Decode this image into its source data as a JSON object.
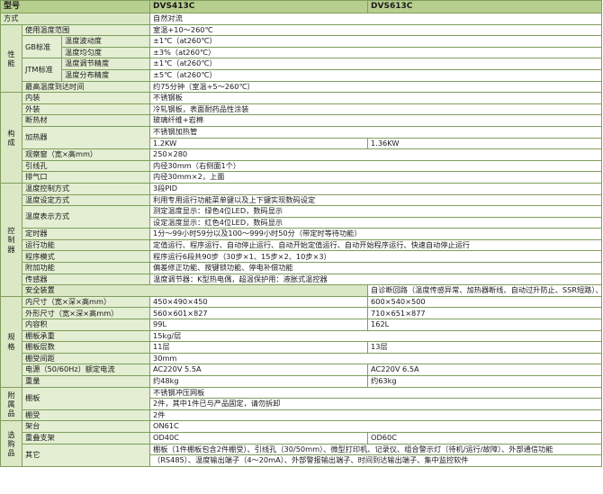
{
  "header": {
    "model": "型号",
    "m1": "DVS413C",
    "m2": "DVS613C"
  },
  "method": {
    "label": "方式",
    "value": "自然对流"
  },
  "performance": {
    "category": "性能",
    "temp_range": {
      "label": "使用温度范围",
      "value": "室温+10～260℃"
    },
    "gb_group": "GB标准",
    "fluctuation": {
      "label": "温度波动度",
      "value": "±1℃（at260℃）"
    },
    "uniformity": {
      "label": "温度均匀度",
      "value": "±3%（at260℃）"
    },
    "jtm_group": "JTM标准",
    "adjust": {
      "label": "温度调节精度",
      "value": "±1℃（at260℃）"
    },
    "distribution": {
      "label": "温度分布精度",
      "value": "±5℃（at260℃）"
    },
    "max_time": {
      "label": "最高温度到达时间",
      "value": "约75分钟（室温+5～260℃）"
    }
  },
  "construction": {
    "category": "构成",
    "inner": {
      "label": "内装",
      "value": "不锈钢板"
    },
    "outer": {
      "label": "外装",
      "value": "冷轧钢板，表面耐药品性涂装"
    },
    "insulation": {
      "label": "断热材",
      "value": "玻璃纤维+岩棉"
    },
    "heater": {
      "label": "加热器",
      "material": "不锈钢加热管",
      "p1": "1.2KW",
      "p2": "1.36KW"
    },
    "window": {
      "label": "观察窗（宽×高mm）",
      "value": "250×280"
    },
    "lead_hole": {
      "label": "引线孔",
      "value": "内径30mm（右侧面1个）"
    },
    "exhaust": {
      "label": "排气口",
      "value": "内径30mm×2，上面"
    }
  },
  "controller": {
    "category": "控制器",
    "control_method": {
      "label": "温度控制方式",
      "value": "3段PID"
    },
    "setting_method": {
      "label": "温度设定方式",
      "value": "利用专用运行功能菜单键以及上下键实现数码设定"
    },
    "display": {
      "label": "温度表示方式",
      "measured": "测定温度显示：绿色4位LED，数码显示",
      "set": "设定温度显示：红色4位LED，数码显示"
    },
    "timer": {
      "label": "定时器",
      "value": "1分～99小时59分以及100～999小时50分（带定时等待功能）"
    },
    "run_func": {
      "label": "运行功能",
      "value": "定值运行、程序运行、自动停止运行、自动开始定值运行、自动开始程序运行、快速自动停止运行"
    },
    "program": {
      "label": "程序模式",
      "value": "程序运行6段共90步（30步×1、15步×2、10步×3）"
    },
    "extra": {
      "label": "附加功能",
      "value": "偏差修正功能、按键锁功能、停电补偿功能"
    },
    "sensor": {
      "label": "传感器",
      "value": "温度调节器：K型热电偶，超温保护用：液胀式温控器"
    }
  },
  "safety": {
    "label": "安全装置",
    "value": "自诊断回路（温度传感异常、加热器断线、自动过升防止、SSR短路）、独立过升防止器、过电流漏电保护开关、按键锁功能"
  },
  "specs": {
    "category": "规格",
    "inner_size": {
      "label": "内尺寸（宽×深×高mm）",
      "v1": "450×490×450",
      "v2": "600×540×500"
    },
    "outer_size": {
      "label": "外形尺寸（宽×深×高mm）",
      "v1": "560×601×827",
      "v2": "710×651×877"
    },
    "volume": {
      "label": "内容积",
      "v1": "99L",
      "v2": "162L"
    },
    "shelf_load": {
      "label": "棚板承重",
      "value": "15kg/层"
    },
    "shelf_count": {
      "label": "棚板层数",
      "v1": "11层",
      "v2": "13层"
    },
    "shelf_gap": {
      "label": "棚受间距",
      "value": "30mm"
    },
    "power": {
      "label": "电源（50/60Hz）额定电流",
      "v1": "AC220V 5.5A",
      "v2": "AC220V 6.5A"
    },
    "weight": {
      "label": "重量",
      "v1": "约48kg",
      "v2": "约63kg"
    }
  },
  "accessories": {
    "category": "附属品",
    "shelf": {
      "label": "棚板",
      "material": "不锈钢冲压网板",
      "note": "2件，其中1件已与产品固定，请勿拆卸"
    },
    "shelf_rest": {
      "label": "棚受",
      "value": "2件"
    }
  },
  "options": {
    "category": "选购品",
    "stand": {
      "label": "架台",
      "value": "ON61C"
    },
    "stack": {
      "label": "重叠支架",
      "v1": "OD40C",
      "v2": "OD60C"
    },
    "other": {
      "label": "其它",
      "line1": "棚板（1件棚板包含2件棚受）、引线孔（30/50mm）、微型打印机、记录仪、组合警示灯（待机/运行/故障）、外部通信功能",
      "line2": "（RS485）、温度输出端子（4～20mA）、外部警报输出端子、时间到达输出端子、集中监控软件"
    }
  }
}
